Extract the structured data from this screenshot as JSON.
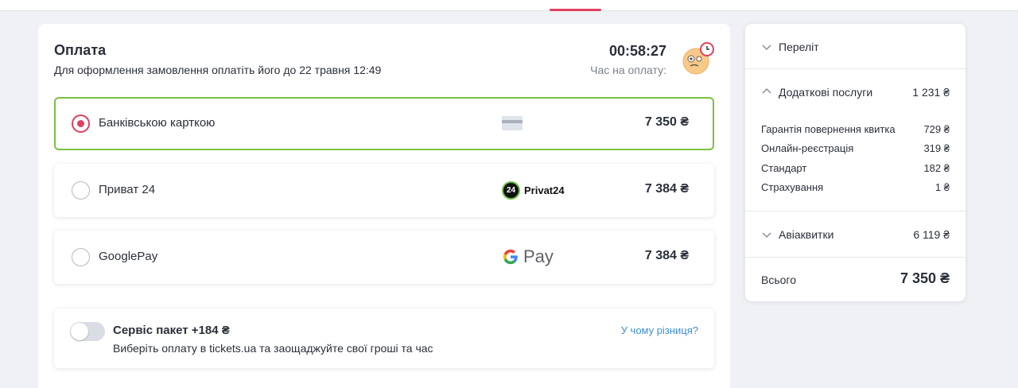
{
  "payment": {
    "title": "Оплата",
    "subtitle": "Для оформлення замовлення оплатіть його до 22 травня 12:49",
    "timer": "00:58:27",
    "timer_label": "Час на оплату:"
  },
  "options": [
    {
      "label": "Банківською карткою",
      "price": "7 350 ₴",
      "logo": "credit-card-icon",
      "selected": true
    },
    {
      "label": "Приват 24",
      "price": "7 384 ₴",
      "logo_badge": "24",
      "logo_text": "Privat24",
      "selected": false
    },
    {
      "label": "GooglePay",
      "price": "7 384 ₴",
      "logo_g": "G",
      "logo_text": "Pay",
      "selected": false
    }
  ],
  "service": {
    "title": "Сервіс пакет +184 ₴",
    "description": "Виберіть оплату в tickets.ua та заощаджуйте свої гроші та час",
    "link": "У чому різниця?",
    "enabled": false
  },
  "summary": {
    "flight": {
      "label": "Переліт"
    },
    "extras": {
      "label": "Додаткові послуги",
      "amount": "1 231 ₴",
      "items": [
        {
          "label": "Гарантія повернення квитка",
          "amount": "729 ₴"
        },
        {
          "label": "Онлайн-реєстрація",
          "amount": "319 ₴"
        },
        {
          "label": "Стандарт",
          "amount": "182 ₴"
        },
        {
          "label": "Страхування",
          "amount": "1 ₴"
        }
      ]
    },
    "tickets": {
      "label": "Авіаквитки",
      "amount": "6 119 ₴"
    },
    "total": {
      "label": "Всього",
      "amount": "7 350 ₴"
    }
  },
  "colors": {
    "accent": "#e0405e",
    "selected_border": "#7cc042",
    "link": "#3a8fd6"
  }
}
